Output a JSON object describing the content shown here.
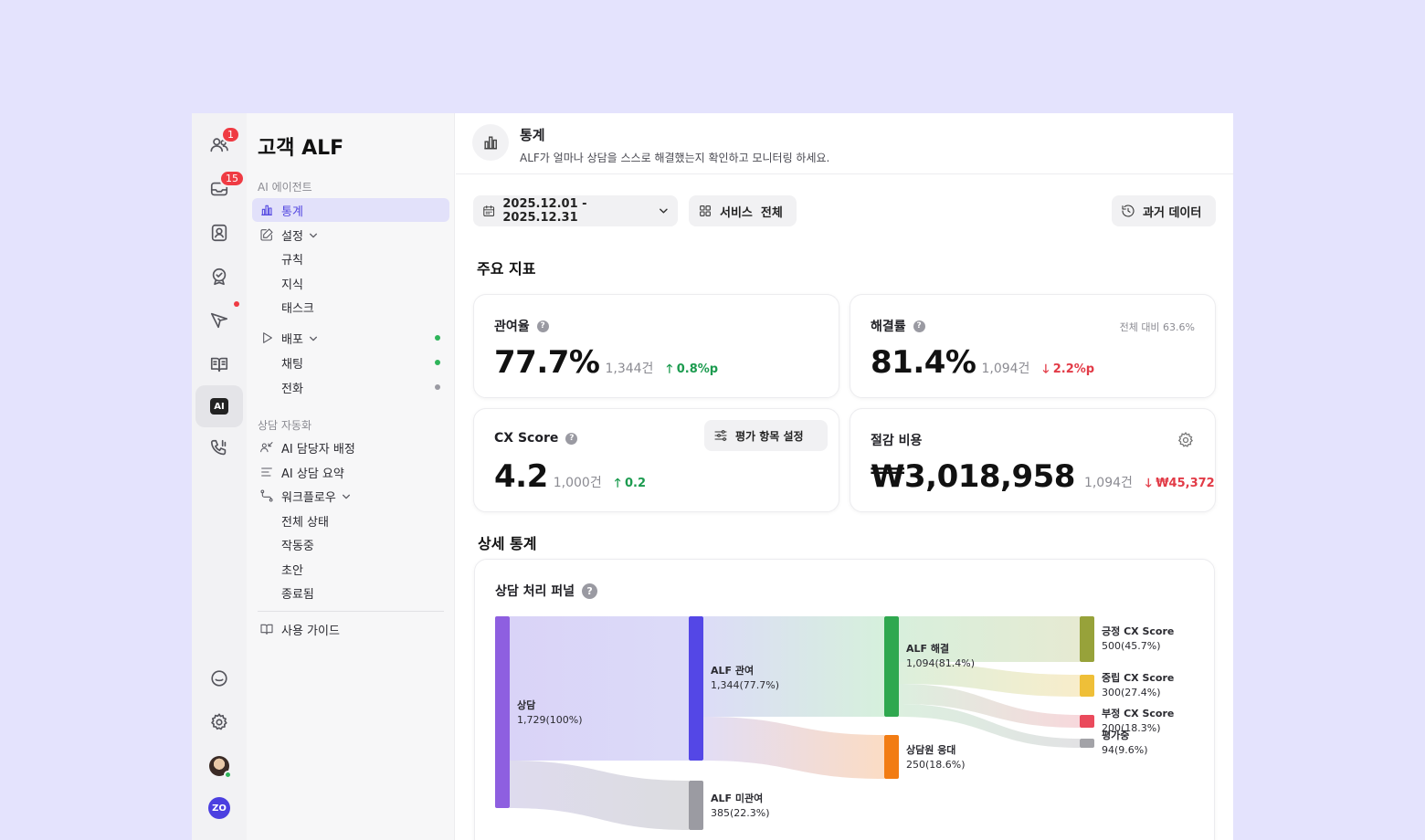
{
  "rail": {
    "badges": {
      "people": "1",
      "inbox": "15"
    },
    "ai_label": "AI",
    "zo_label": "ZO"
  },
  "sidebar": {
    "title": "고객 ALF",
    "section_agent": "AI 에이전트",
    "items": {
      "stats": "통계",
      "settings": "설정",
      "rules": "규칙",
      "knowledge": "지식",
      "task": "태스크",
      "deploy": "배포",
      "chat": "채팅",
      "phone": "전화"
    },
    "section_automation": "상담 자동화",
    "automation": {
      "assign": "AI 담당자 배정",
      "summary": "AI 상담 요약",
      "workflow": "워크플로우",
      "all_status": "전체 상태",
      "running": "작동중",
      "draft": "초안",
      "ended": "종료됨"
    },
    "guide": "사용 가이드",
    "colors": {
      "green": "#2fb45a",
      "gray": "#9a9aa2"
    }
  },
  "header": {
    "title": "통계",
    "subtitle": "ALF가 얼마나 상담을 스스로 해결했는지 확인하고 모니터링 하세요."
  },
  "toolbar": {
    "date_range": "2025.12.01 - 2025.12.31",
    "service": "서비스  전체",
    "history": "과거 데이터"
  },
  "key_metrics": {
    "title": "주요 지표",
    "involvement": {
      "label": "관여율",
      "value": "77.7%",
      "count": "1,344건",
      "delta": "0.8%p"
    },
    "resolution": {
      "label": "해결률",
      "value": "81.4%",
      "count": "1,094건",
      "delta": "2.2%p",
      "note": "전체 대비 63.6%"
    },
    "cx": {
      "label": "CX Score",
      "value": "4.2",
      "count": "1,000건",
      "delta": "0.2",
      "settings_button": "평가 항목 설정"
    },
    "savings": {
      "label": "절감 비용",
      "value": "₩3,018,958",
      "count": "1,094건",
      "delta": "₩45,372"
    }
  },
  "detail": {
    "title": "상세 통계",
    "funnel_title": "상담 처리 퍼널"
  },
  "sankey": {
    "nodes": {
      "consult": {
        "name": "상담",
        "value": "1,729(100%)",
        "color": "#8e5fe0"
      },
      "alf_involved": {
        "name": "ALF 관여",
        "value": "1,344(77.7%)",
        "color": "#5447e6"
      },
      "alf_not": {
        "name": "ALF 미관여",
        "value": "385(22.3%)",
        "color": "#9b9ba2"
      },
      "alf_resolved": {
        "name": "ALF 해결",
        "value": "1,094(81.4%)",
        "color": "#2fa84f"
      },
      "agent": {
        "name": "상담원 응대",
        "value": "250(18.6%)",
        "color": "#f27c13"
      },
      "positive": {
        "name": "긍정 CX Score",
        "value": "500(45.7%)",
        "color": "#97a23a"
      },
      "neutral": {
        "name": "중립 CX Score",
        "value": "300(27.4%)",
        "color": "#efbf38"
      },
      "negative": {
        "name": "부정 CX Score",
        "value": "200(18.3%)",
        "color": "#ea4a5c"
      },
      "pending": {
        "name": "평가중",
        "value": "94(9.6%)",
        "color": "#a3a3a8"
      }
    }
  }
}
